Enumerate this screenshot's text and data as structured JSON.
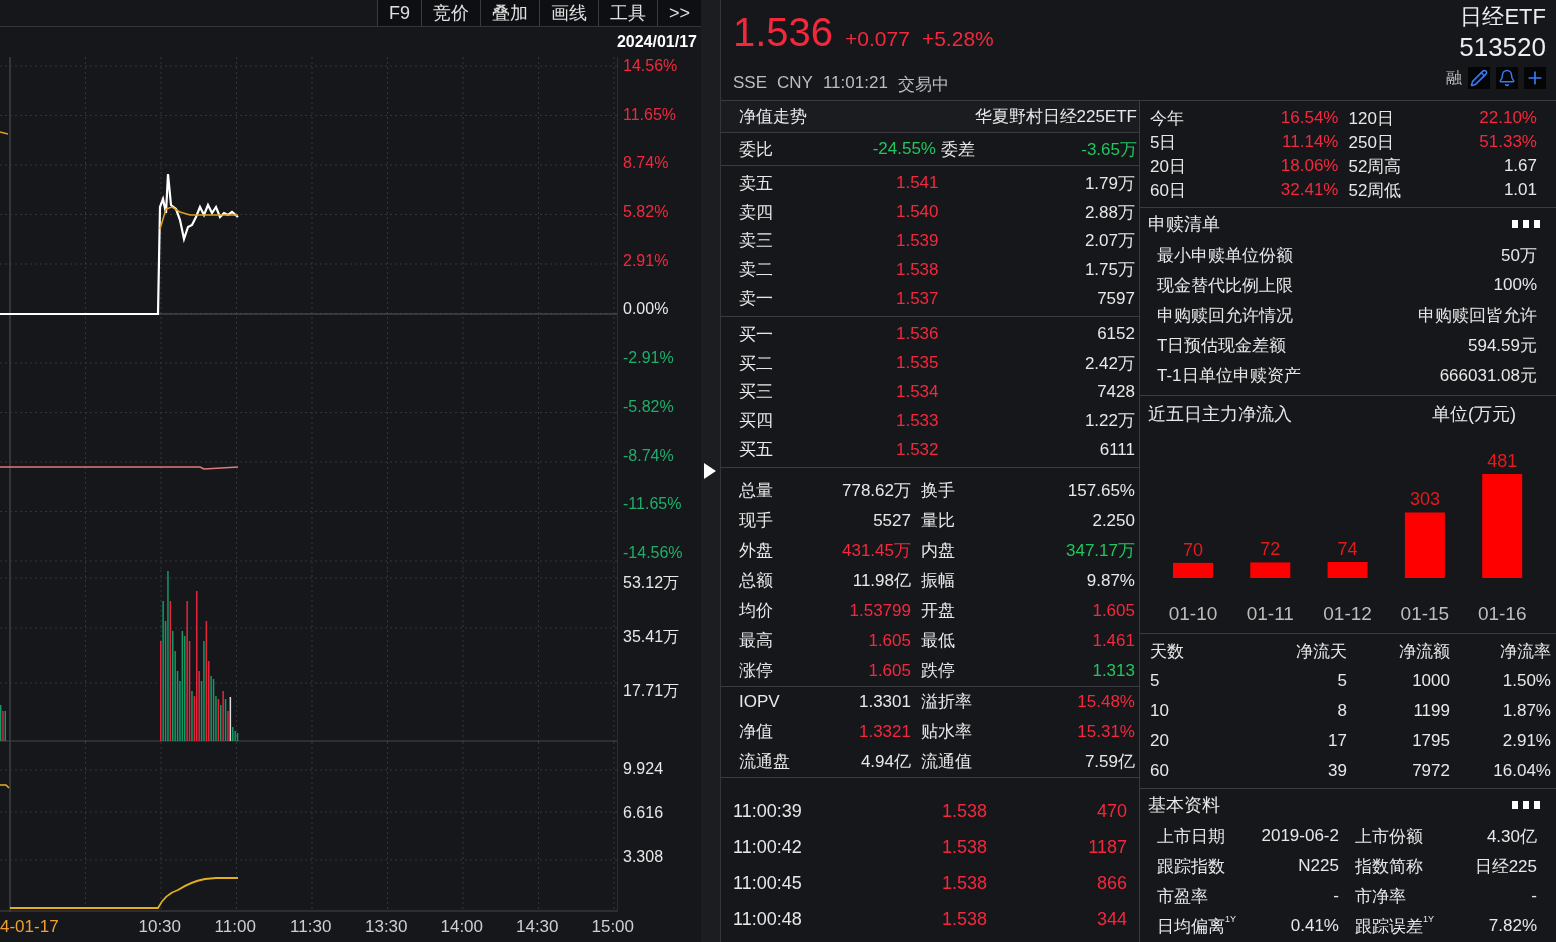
{
  "toolbar": {
    "buttons": [
      "F9",
      "竞价",
      "叠加",
      "画线",
      "工具",
      ">>"
    ]
  },
  "chart": {
    "date": "2024/01/17",
    "price_axis": [
      {
        "label": "14.56%",
        "color": "#f3283d"
      },
      {
        "label": "11.65%",
        "color": "#f3283d"
      },
      {
        "label": "8.74%",
        "color": "#f3283d"
      },
      {
        "label": "5.82%",
        "color": "#f3283d"
      },
      {
        "label": "2.91%",
        "color": "#f3283d"
      },
      {
        "label": "0.00%",
        "color": "#e8e8e8"
      },
      {
        "label": "-2.91%",
        "color": "#1fae6a"
      },
      {
        "label": "-5.82%",
        "color": "#1fae6a"
      },
      {
        "label": "-8.74%",
        "color": "#1fae6a"
      },
      {
        "label": "-11.65%",
        "color": "#1fae6a"
      },
      {
        "label": "-14.56%",
        "color": "#1fae6a"
      }
    ],
    "volume_axis": [
      "53.12万",
      "35.41万",
      "17.71万"
    ],
    "indicator_axis": [
      "9.924",
      "6.616",
      "3.308"
    ],
    "time_axis": [
      {
        "label": "4-01-17",
        "kind": "date"
      },
      {
        "label": "10:30",
        "kind": "time"
      },
      {
        "label": "11:00",
        "kind": "time"
      },
      {
        "label": "11:30",
        "kind": "time"
      },
      {
        "label": "13:30",
        "kind": "time"
      },
      {
        "label": "14:00",
        "kind": "time"
      },
      {
        "label": "14:30",
        "kind": "time"
      },
      {
        "label": "15:00",
        "kind": "time"
      }
    ]
  },
  "quote": {
    "price": "1.536",
    "change": "+0.077",
    "change_pct": "+5.28%",
    "color": "#f3283d",
    "exchange": "SSE",
    "currency": "CNY",
    "time": "11:01:21",
    "status": "交易中",
    "name": "日经ETF",
    "code": "513520",
    "margin_tag": "融"
  },
  "nav_row": {
    "label": "净值走势",
    "fund": "华夏野村日经225ETF"
  },
  "order_ratio": {
    "label": "委比",
    "value": "-24.55%",
    "diff_label": "委差",
    "diff": "-3.65万",
    "color": "#22c55e"
  },
  "asks": [
    {
      "label": "卖五",
      "price": "1.541",
      "volume": "1.79万"
    },
    {
      "label": "卖四",
      "price": "1.540",
      "volume": "2.88万"
    },
    {
      "label": "卖三",
      "price": "1.539",
      "volume": "2.07万"
    },
    {
      "label": "卖二",
      "price": "1.538",
      "volume": "1.75万"
    },
    {
      "label": "卖一",
      "price": "1.537",
      "volume": "7597"
    }
  ],
  "bids": [
    {
      "label": "买一",
      "price": "1.536",
      "volume": "6152"
    },
    {
      "label": "买二",
      "price": "1.535",
      "volume": "2.42万"
    },
    {
      "label": "买三",
      "price": "1.534",
      "volume": "7428"
    },
    {
      "label": "买四",
      "price": "1.533",
      "volume": "1.22万"
    },
    {
      "label": "买五",
      "price": "1.532",
      "volume": "6111"
    }
  ],
  "stats": [
    {
      "label": "总量",
      "value": "778.62万",
      "color": "#e8e8e8"
    },
    {
      "label": "换手",
      "value": "157.65%",
      "color": "#e8e8e8"
    },
    {
      "label": "现手",
      "value": "5527",
      "color": "#e8e8e8"
    },
    {
      "label": "量比",
      "value": "2.250",
      "color": "#e8e8e8"
    },
    {
      "label": "外盘",
      "value": "431.45万",
      "color": "#f3283d"
    },
    {
      "label": "内盘",
      "value": "347.17万",
      "color": "#22c55e"
    },
    {
      "label": "总额",
      "value": "11.98亿",
      "color": "#e8e8e8"
    },
    {
      "label": "振幅",
      "value": "9.87%",
      "color": "#e8e8e8"
    },
    {
      "label": "均价",
      "value": "1.53799",
      "color": "#f3283d"
    },
    {
      "label": "开盘",
      "value": "1.605",
      "color": "#f3283d"
    },
    {
      "label": "最高",
      "value": "1.605",
      "color": "#f3283d"
    },
    {
      "label": "最低",
      "value": "1.461",
      "color": "#f3283d"
    },
    {
      "label": "涨停",
      "value": "1.605",
      "color": "#f3283d"
    },
    {
      "label": "跌停",
      "value": "1.313",
      "color": "#22c55e"
    }
  ],
  "fund_stats": [
    {
      "label": "IOPV",
      "value": "1.3301",
      "color": "#e8e8e8"
    },
    {
      "label": "溢折率",
      "value": "15.48%",
      "color": "#f3283d"
    },
    {
      "label": "净值",
      "value": "1.3321",
      "color": "#f3283d"
    },
    {
      "label": "贴水率",
      "value": "15.31%",
      "color": "#f3283d"
    },
    {
      "label": "流通盘",
      "value": "4.94亿",
      "color": "#e8e8e8"
    },
    {
      "label": "流通值",
      "value": "7.59亿",
      "color": "#e8e8e8"
    }
  ],
  "trades": [
    {
      "time": "11:00:39",
      "price": "1.538",
      "volume": "470",
      "color": "#f3283d"
    },
    {
      "time": "11:00:42",
      "price": "1.538",
      "volume": "1187",
      "color": "#f3283d"
    },
    {
      "time": "11:00:45",
      "price": "1.538",
      "volume": "866",
      "color": "#f3283d"
    },
    {
      "time": "11:00:48",
      "price": "1.538",
      "volume": "344",
      "color": "#f3283d"
    }
  ],
  "returns": [
    {
      "label": "今年",
      "value": "16.54%",
      "color": "#f3283d"
    },
    {
      "label": "120日",
      "value": "22.10%",
      "color": "#f3283d"
    },
    {
      "label": "5日",
      "value": "11.14%",
      "color": "#f3283d"
    },
    {
      "label": "250日",
      "value": "51.33%",
      "color": "#f3283d"
    },
    {
      "label": "20日",
      "value": "18.06%",
      "color": "#f3283d"
    },
    {
      "label": "52周高",
      "value": "1.67",
      "color": "#e8e8e8"
    },
    {
      "label": "60日",
      "value": "32.41%",
      "color": "#f3283d"
    },
    {
      "label": "52周低",
      "value": "1.01",
      "color": "#e8e8e8"
    }
  ],
  "creation_redemption": {
    "title": "申赎清单",
    "rows": [
      {
        "label": "最小申赎单位份额",
        "value": "50万"
      },
      {
        "label": "现金替代比例上限",
        "value": "100%"
      },
      {
        "label": "申购赎回允许情况",
        "value": "申购赎回皆允许"
      },
      {
        "label": "T日预估现金差额",
        "value": "594.59元"
      },
      {
        "label": "T-1日单位申赎资产",
        "value": "666031.08元"
      }
    ]
  },
  "fund_flow": {
    "chart_data": {
      "type": "bar",
      "title": "近五日主力净流入",
      "ylabel": "单位(万元)",
      "categories": [
        "01-10",
        "01-11",
        "01-12",
        "01-15",
        "01-16"
      ],
      "series": [
        {
          "color": "#ff0000",
          "values": [
            70,
            72,
            74,
            303,
            481
          ]
        }
      ],
      "data_labels": true
    }
  },
  "flow_table": {
    "columns": [
      "天数",
      "净流天",
      "净流额",
      "净流率"
    ],
    "rows": [
      [
        "5",
        "5",
        "1000",
        "1.50%"
      ],
      [
        "10",
        "8",
        "1199",
        "1.87%"
      ],
      [
        "20",
        "17",
        "1795",
        "2.91%"
      ],
      [
        "60",
        "39",
        "7972",
        "16.04%"
      ]
    ]
  },
  "profile": {
    "title": "基本资料",
    "items": [
      {
        "label": "上市日期",
        "value": "2019-06-2"
      },
      {
        "label": "上市份额",
        "value": "4.30亿"
      },
      {
        "label": "跟踪指数",
        "value": "N225"
      },
      {
        "label": "指数简称",
        "value": "日经225"
      },
      {
        "label": "市盈率",
        "value": "-"
      },
      {
        "label": "市净率",
        "value": "-"
      },
      {
        "label": "日均偏离$^{1Y}$",
        "value": "0.41%"
      },
      {
        "label": "跟踪误差$^{1Y}$",
        "value": "7.82%"
      }
    ]
  }
}
